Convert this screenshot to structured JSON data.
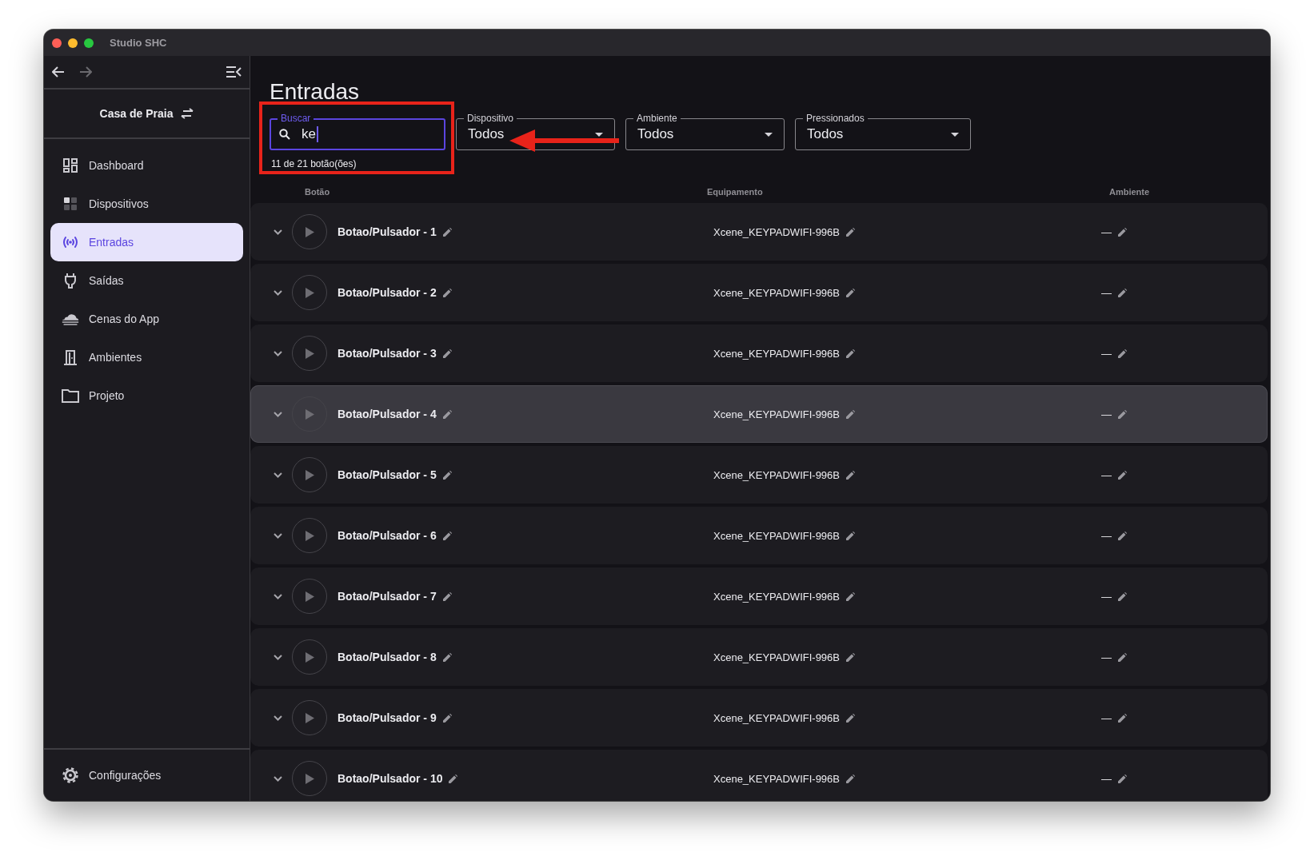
{
  "window": {
    "title": "Studio SHC"
  },
  "sidebar": {
    "project": "Casa de Praia",
    "items": [
      {
        "label": "Dashboard",
        "selected": false
      },
      {
        "label": "Dispositivos",
        "selected": false
      },
      {
        "label": "Entradas",
        "selected": true
      },
      {
        "label": "Saídas",
        "selected": false
      },
      {
        "label": "Cenas do App",
        "selected": false
      },
      {
        "label": "Ambientes",
        "selected": false
      },
      {
        "label": "Projeto",
        "selected": false
      }
    ],
    "footer_item": {
      "label": "Configurações"
    }
  },
  "page": {
    "title": "Entradas"
  },
  "filters": {
    "search": {
      "label": "Buscar",
      "value": "ke",
      "result_count": "11 de 21 botão(ões)"
    },
    "selects": [
      {
        "label": "Dispositivo",
        "value": "Todos"
      },
      {
        "label": "Ambiente",
        "value": "Todos"
      },
      {
        "label": "Pressionados",
        "value": "Todos"
      }
    ]
  },
  "table": {
    "columns": [
      "Botão",
      "Equipamento",
      "Ambiente"
    ],
    "rows": [
      {
        "name": "Botao/Pulsador - 1",
        "equipment": "Xcene_KEYPADWIFI-996B",
        "room": "—",
        "hovered": false
      },
      {
        "name": "Botao/Pulsador - 2",
        "equipment": "Xcene_KEYPADWIFI-996B",
        "room": "—",
        "hovered": false
      },
      {
        "name": "Botao/Pulsador - 3",
        "equipment": "Xcene_KEYPADWIFI-996B",
        "room": "—",
        "hovered": false
      },
      {
        "name": "Botao/Pulsador - 4",
        "equipment": "Xcene_KEYPADWIFI-996B",
        "room": "—",
        "hovered": true
      },
      {
        "name": "Botao/Pulsador - 5",
        "equipment": "Xcene_KEYPADWIFI-996B",
        "room": "—",
        "hovered": false
      },
      {
        "name": "Botao/Pulsador - 6",
        "equipment": "Xcene_KEYPADWIFI-996B",
        "room": "—",
        "hovered": false
      },
      {
        "name": "Botao/Pulsador - 7",
        "equipment": "Xcene_KEYPADWIFI-996B",
        "room": "—",
        "hovered": false
      },
      {
        "name": "Botao/Pulsador - 8",
        "equipment": "Xcene_KEYPADWIFI-996B",
        "room": "—",
        "hovered": false
      },
      {
        "name": "Botao/Pulsador - 9",
        "equipment": "Xcene_KEYPADWIFI-996B",
        "room": "—",
        "hovered": false
      },
      {
        "name": "Botao/Pulsador - 10",
        "equipment": "Xcene_KEYPADWIFI-996B",
        "room": "—",
        "hovered": false
      }
    ]
  }
}
